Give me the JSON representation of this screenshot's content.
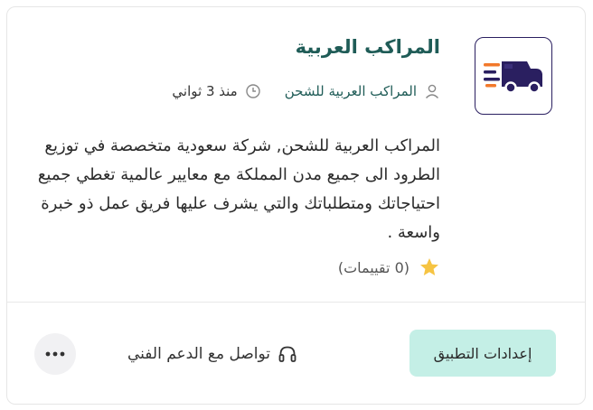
{
  "app": {
    "title": "المراكب العربية",
    "publisher": "المراكب العربية للشحن",
    "published_time": "منذ 3 ثواني",
    "description": "المراكب العربية للشحن, شركة سعودية متخصصة في توزيع الطرود الى جميع مدن المملكة مع معايير عالمية تغطي جميع احتياجاتك ومتطلباتك والتي يشرف عليها فريق عمل ذو خبرة واسعة .",
    "rating_text": "(0 تقييمات)",
    "logo_icon": "delivery-truck-icon"
  },
  "actions": {
    "settings_label": "إعدادات التطبيق",
    "support_label": "تواصل مع الدعم الفني",
    "more_icon": "more-dots-icon"
  },
  "colors": {
    "title": "#1f5c57",
    "settings_button_bg": "#c4efe6",
    "logo_border": "#2a1f60",
    "star": "#f6c443",
    "truck_orange": "#f2792b",
    "truck_navy": "#2a1f60"
  }
}
